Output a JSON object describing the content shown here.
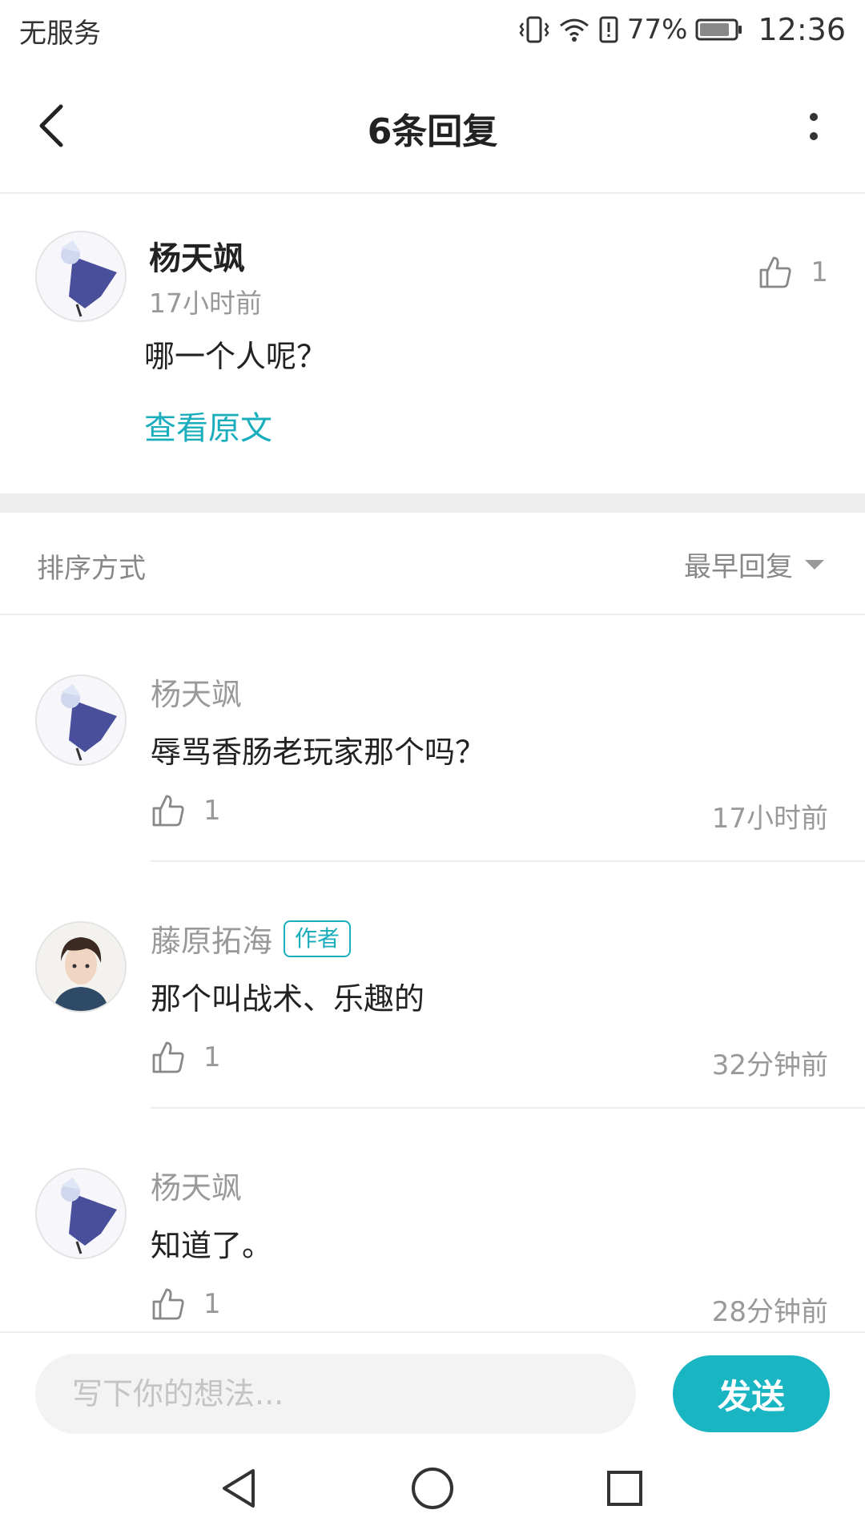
{
  "status_bar": {
    "carrier": "无服务",
    "battery": "77%",
    "time": "12:36"
  },
  "header": {
    "title": "6条回复",
    "back_icon": "back-chevron-icon",
    "more_icon": "more-vertical-icon"
  },
  "original": {
    "author": "杨天飒",
    "time": "17小时前",
    "text": "哪一个人呢？",
    "view_original": "查看原文",
    "likes": "1"
  },
  "sort": {
    "label": "排序方式",
    "value": "最早回复"
  },
  "replies": [
    {
      "author": "杨天飒",
      "badge": "",
      "text": "辱骂香肠老玩家那个吗？",
      "likes": "1",
      "time": "17小时前"
    },
    {
      "author": "藤原拓海",
      "badge": "作者",
      "text": "那个叫战术、乐趣的",
      "likes": "1",
      "time": "32分钟前"
    },
    {
      "author": "杨天飒",
      "badge": "",
      "text": "知道了。",
      "likes": "1",
      "time": "28分钟前"
    }
  ],
  "input": {
    "placeholder": "写下你的想法...",
    "send_label": "发送"
  },
  "colors": {
    "accent": "#1aaebd",
    "send_button": "#1ab5c2",
    "muted_text": "#999999"
  }
}
